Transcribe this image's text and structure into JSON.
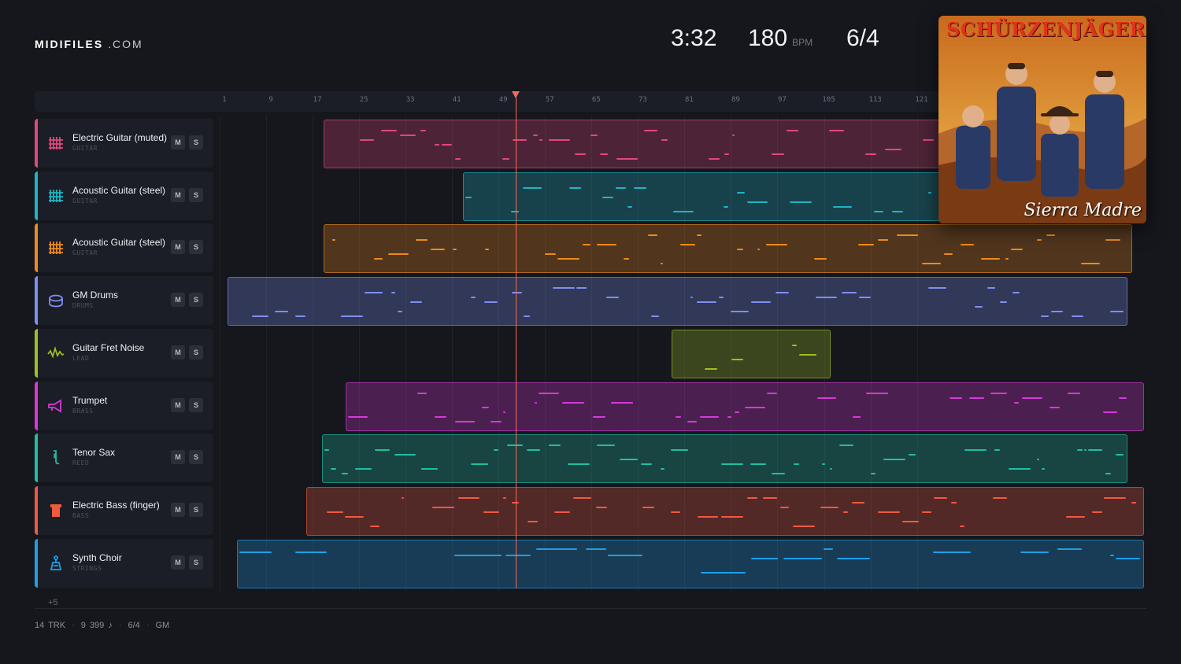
{
  "header": {
    "logo_bold": "MIDIFILES",
    "logo_light": ".COM",
    "time": "3:32",
    "tempo": "180",
    "tempo_unit": "BPM",
    "meter": "6/4"
  },
  "ruler": {
    "bars": [
      "1",
      "9",
      "17",
      "25",
      "33",
      "41",
      "49",
      "57",
      "65",
      "73",
      "81",
      "89",
      "97",
      "105",
      "113",
      "121"
    ]
  },
  "playhead_bar": 50,
  "tracks": [
    {
      "name": "Electric Guitar (muted)",
      "category": "GUITAR",
      "color": "#e0477f",
      "icon": "guitar-grid-icon",
      "mute": "M",
      "solo": "S"
    },
    {
      "name": "Acoustic Guitar (steel)",
      "category": "GUITAR",
      "color": "#1fb5c4",
      "icon": "guitar-grid-icon",
      "mute": "M",
      "solo": "S"
    },
    {
      "name": "Acoustic Guitar (steel)",
      "category": "GUITAR",
      "color": "#ee8a1f",
      "icon": "guitar-grid-icon",
      "mute": "M",
      "solo": "S"
    },
    {
      "name": "GM Drums",
      "category": "DRUMS",
      "color": "#7d8ff0",
      "icon": "drum-icon",
      "mute": "M",
      "solo": "S"
    },
    {
      "name": "Guitar Fret Noise",
      "category": "LEAD",
      "color": "#9fbf24",
      "icon": "waveform-icon",
      "mute": "M",
      "solo": "S"
    },
    {
      "name": "Trumpet",
      "category": "BRASS",
      "color": "#d838d8",
      "icon": "trumpet-icon",
      "mute": "M",
      "solo": "S"
    },
    {
      "name": "Tenor Sax",
      "category": "REED",
      "color": "#1fbfa5",
      "icon": "sax-icon",
      "mute": "M",
      "solo": "S"
    },
    {
      "name": "Electric Bass (finger)",
      "category": "BASS",
      "color": "#ef5a40",
      "icon": "bass-icon",
      "mute": "M",
      "solo": "S"
    },
    {
      "name": "Synth Choir",
      "category": "STRINGS",
      "color": "#1f9fe8",
      "icon": "choir-icon",
      "mute": "M",
      "solo": "S"
    }
  ],
  "more_tracks": "+5",
  "footer": {
    "tracks": "14 TRK",
    "notes": "9 399 ♪",
    "meter": "6/4",
    "standard": "GM"
  },
  "cover": {
    "title": "SCHÜRZENJÄGER",
    "subtitle": "Sierra Madre"
  }
}
